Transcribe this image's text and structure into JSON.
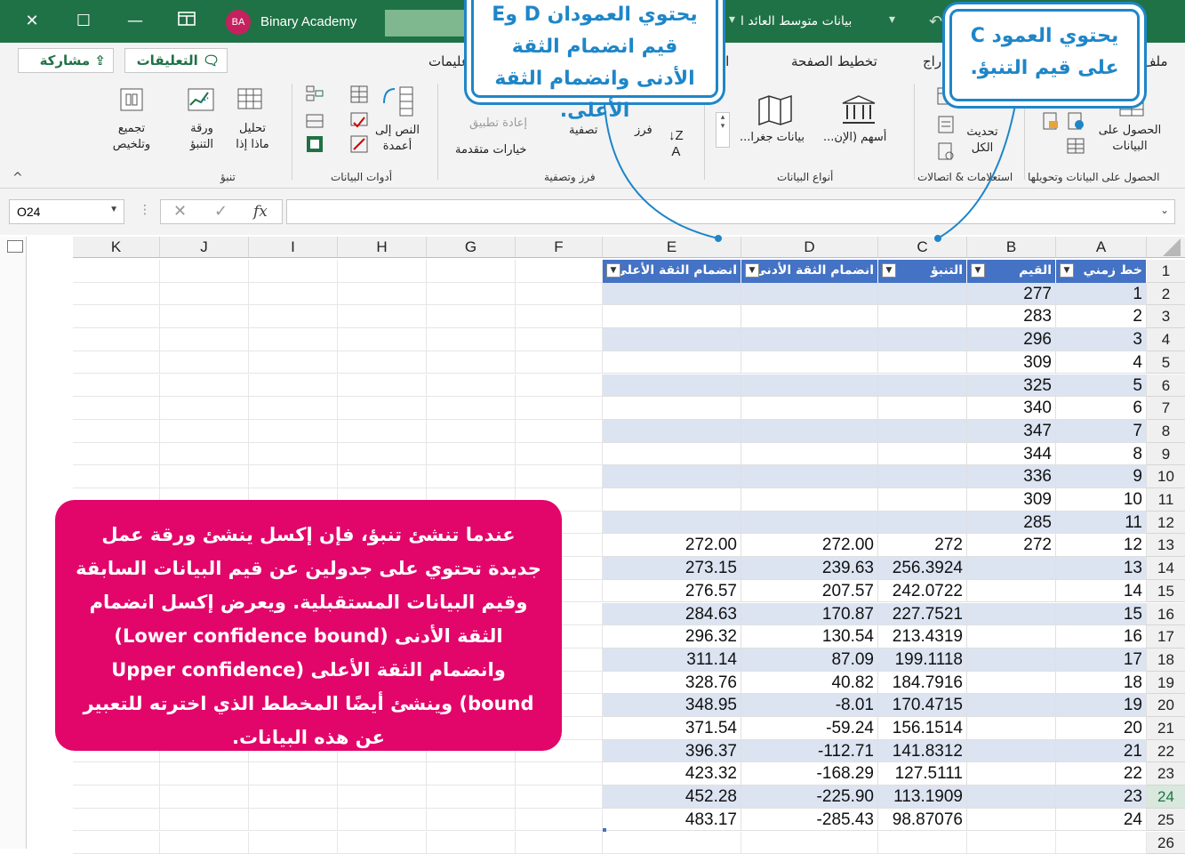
{
  "titlebar": {
    "account_initials": "BA",
    "account_name": "Binary Academy",
    "filename": "بيانات متوسط العائد ا",
    "close_glyph": "✕",
    "restore_glyph": "☐",
    "minimize_glyph": "—"
  },
  "tabs": {
    "share": "مشاركة",
    "comments": "التعليقات",
    "items": [
      "عليمات",
      "الصيغ",
      "تخطيط الصفحة",
      "دراج",
      "ملف"
    ]
  },
  "ribbon": {
    "forecast": {
      "consolidate": "تجميع\nوتلخيص",
      "forecast_sheet": "ورقة\nالتنبؤ",
      "whatif": "تحليل\nماذا إذا",
      "group": "تنبؤ"
    },
    "data_tools": {
      "text_to_columns": "النص إلى\nأعمدة",
      "group": "أدوات البيانات"
    },
    "sort_filter": {
      "reapply": "إعادة تطبيق",
      "advanced": "خيارات متقدمة",
      "filter": "تصفية",
      "sort": "فرز",
      "group": "فرز وتصفية"
    },
    "data_types": {
      "stocks": "أسهم (الإن...",
      "geography": "بيانات جغرا...",
      "group": "أنواع البيانات"
    },
    "queries": {
      "refresh_all": "تحديث\nالكل",
      "group": "استعلامات & اتصالات"
    },
    "get_data": {
      "get_data": "الحصول على\nالبيانات",
      "group": "الحصول على البيانات وتحويلها"
    }
  },
  "formula_bar": {
    "name_box": "O24",
    "fx": "fx"
  },
  "columns": [
    "K",
    "J",
    "I",
    "H",
    "G",
    "F",
    "E",
    "D",
    "C",
    "B",
    "A"
  ],
  "table_headers": [
    "خط زمني",
    "القيم",
    "التنبؤ",
    "انضمام الثقة الأدنى",
    "انضمام الثقة الأعلى"
  ],
  "rows": [
    [
      "1",
      "277",
      "",
      "",
      ""
    ],
    [
      "2",
      "283",
      "",
      "",
      ""
    ],
    [
      "3",
      "296",
      "",
      "",
      ""
    ],
    [
      "4",
      "309",
      "",
      "",
      ""
    ],
    [
      "5",
      "325",
      "",
      "",
      ""
    ],
    [
      "6",
      "340",
      "",
      "",
      ""
    ],
    [
      "7",
      "347",
      "",
      "",
      ""
    ],
    [
      "8",
      "344",
      "",
      "",
      ""
    ],
    [
      "9",
      "336",
      "",
      "",
      ""
    ],
    [
      "10",
      "309",
      "",
      "",
      ""
    ],
    [
      "11",
      "285",
      "",
      "",
      ""
    ],
    [
      "12",
      "272",
      "272",
      "272.00",
      "272.00"
    ],
    [
      "13",
      "",
      "256.3924",
      "239.63",
      "273.15"
    ],
    [
      "14",
      "",
      "242.0722",
      "207.57",
      "276.57"
    ],
    [
      "15",
      "",
      "227.7521",
      "170.87",
      "284.63"
    ],
    [
      "16",
      "",
      "213.4319",
      "130.54",
      "296.32"
    ],
    [
      "17",
      "",
      "199.1118",
      "87.09",
      "311.14"
    ],
    [
      "18",
      "",
      "184.7916",
      "40.82",
      "328.76"
    ],
    [
      "19",
      "",
      "170.4715",
      "-8.01",
      "348.95"
    ],
    [
      "20",
      "",
      "156.1514",
      "-59.24",
      "371.54"
    ],
    [
      "21",
      "",
      "141.8312",
      "-112.71",
      "396.37"
    ],
    [
      "22",
      "",
      "127.5111",
      "-168.29",
      "423.32"
    ],
    [
      "23",
      "",
      "113.1909",
      "-225.90",
      "452.28"
    ],
    [
      "24",
      "",
      "98.87076",
      "-285.43",
      "483.17"
    ]
  ],
  "row_numbers": [
    "1",
    "2",
    "3",
    "4",
    "5",
    "6",
    "7",
    "8",
    "9",
    "10",
    "11",
    "12",
    "13",
    "14",
    "15",
    "16",
    "17",
    "18",
    "19",
    "20",
    "21",
    "22",
    "23",
    "24",
    "25",
    "26"
  ],
  "callouts": {
    "col_c": "يحتوي العمود C على قيم التنبؤ.",
    "col_de": "يحتوي العمودان D وE قيم انضمام الثقة الأدنى وانضمام الثقة الأعلى.",
    "note": "عندما تنشئ تنبؤ، فإن إكسل ينشئ ورقة عمل جديدة تحتوي على جدولين عن قيم البيانات السابقة وقيم البيانات المستقبلية. ويعرض إكسل انضمام الثقة الأدنى (Lower confidence bound) وانضمام الثقة الأعلى (Upper confidence bound)  وينشئ أيضًا المخطط الذي اخترته للتعبير عن هذه البيانات."
  },
  "colors": {
    "excel_green": "#1f7245",
    "table_header": "#4472c4",
    "band": "#dce4f2",
    "callout_blue": "#1e86c8",
    "callout_pink": "#e2066a"
  }
}
